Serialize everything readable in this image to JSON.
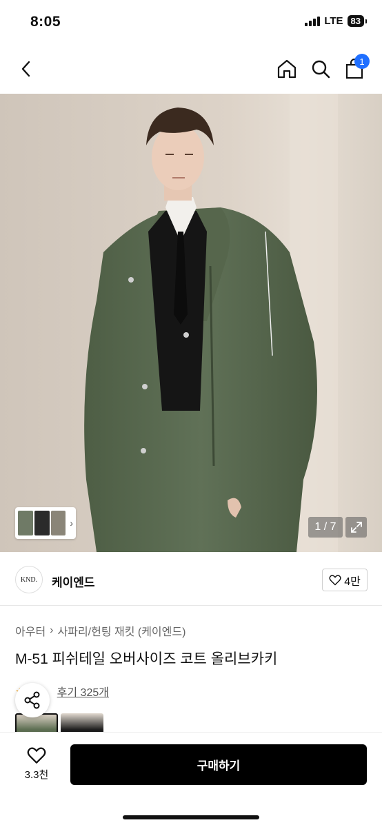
{
  "status_bar": {
    "time": "8:05",
    "network": "LTE",
    "battery": "83"
  },
  "nav": {
    "back_icon": "chevron-left-icon",
    "home_icon": "home-icon",
    "search_icon": "search-icon",
    "cart_icon": "shopping-bag-icon",
    "cart_count": "1"
  },
  "gallery": {
    "counter": "1 / 7",
    "expand_icon": "expand-icon"
  },
  "brand": {
    "logo_text": "KND.",
    "name": "케이엔드",
    "likes": "4만"
  },
  "breadcrumb": {
    "category": "아우터",
    "separator": "›",
    "subcategory": "사파리/헌팅 재킷 (케이엔드)"
  },
  "product": {
    "title": "M-51 피쉬테일 오버사이즈 코트 올리브카키"
  },
  "reviews": {
    "label": "후기 325개"
  },
  "bottom": {
    "wish_count": "3.3천",
    "buy_label": "구매하기"
  },
  "colors": {
    "accent": "#1f6fff",
    "coat": "#5d6e52",
    "buy_button": "#000000"
  }
}
